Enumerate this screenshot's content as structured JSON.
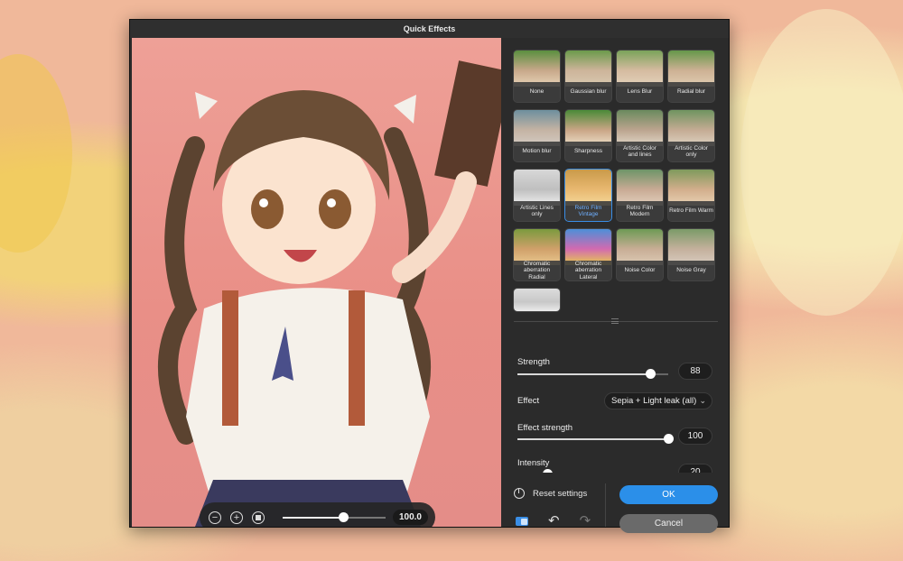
{
  "dialog": {
    "title": "Quick Effects"
  },
  "effects": [
    {
      "label": "None",
      "colors": [
        "#5a8f3f",
        "#c7a88a",
        "#e8d4b8"
      ]
    },
    {
      "label": "Gaussian blur",
      "colors": [
        "#6b9a4b",
        "#cdb49a",
        "#d8c9b0"
      ]
    },
    {
      "label": "Lens Blur",
      "colors": [
        "#7aa35a",
        "#d5bba0",
        "#e3d3bb"
      ]
    },
    {
      "label": "Radial blur",
      "colors": [
        "#65974a",
        "#cdb194",
        "#dfcdb2"
      ]
    },
    {
      "label": "Motion blur",
      "colors": [
        "#6d8f9e",
        "#c4b3a3",
        "#d3cbc3"
      ]
    },
    {
      "label": "Sharpness",
      "colors": [
        "#4a8a38",
        "#c9a585",
        "#eee0c9"
      ]
    },
    {
      "label": "Artistic Color and lines",
      "colors": [
        "#6a8a5e",
        "#bba48e",
        "#e1d7c8"
      ]
    },
    {
      "label": "Artistic Color only",
      "colors": [
        "#6f9460",
        "#c4ab93",
        "#ddd2c2"
      ]
    },
    {
      "label": "Artistic Lines only",
      "colors": [
        "#d8d8d8",
        "#bfbfbf",
        "#f0f0f0"
      ]
    },
    {
      "label": "Retro Film Vintage",
      "colors": [
        "#c99a4a",
        "#e8b870",
        "#f5d89a"
      ]
    },
    {
      "label": "Retro Film Modern",
      "colors": [
        "#6d9468",
        "#c8aa94",
        "#e2d0bd"
      ]
    },
    {
      "label": "Retro Film Warm",
      "colors": [
        "#7e9a5c",
        "#d2ae8c",
        "#e8d2b4"
      ]
    },
    {
      "label": "Chromatic aberration Radial",
      "colors": [
        "#7a9a3e",
        "#d0a06a",
        "#e9c98f"
      ]
    },
    {
      "label": "Chromatic aberration Lateral",
      "colors": [
        "#4d8fd8",
        "#d26ab0",
        "#e8d049"
      ]
    },
    {
      "label": "Noise Color",
      "colors": [
        "#6d9a55",
        "#c8ad95",
        "#dccbb6"
      ]
    },
    {
      "label": "Noise Gray",
      "colors": [
        "#7b9a68",
        "#c4b09c",
        "#d8ccc0"
      ]
    },
    {
      "label": "",
      "colors": [
        "#dcdcdc",
        "#c8c8c8",
        "#f2f2f2"
      ]
    }
  ],
  "selected_effect": "Retro Film Vintage",
  "controls": {
    "strength": {
      "label": "Strength",
      "value": "88",
      "fraction": 0.88
    },
    "effect": {
      "label": "Effect",
      "value": "Sepia + Light leak (all)"
    },
    "effect_strength": {
      "label": "Effect strength",
      "value": "100",
      "fraction": 1.0
    },
    "intensity": {
      "label": "Intensity",
      "value": "20",
      "fraction": 0.2
    }
  },
  "zoom": {
    "value": "100.0",
    "fraction": 0.59
  },
  "actions": {
    "reset": "Reset settings",
    "ok": "OK",
    "cancel": "Cancel"
  },
  "colors": {
    "accent": "#2b8fe9",
    "panel": "#2b2b2b"
  }
}
